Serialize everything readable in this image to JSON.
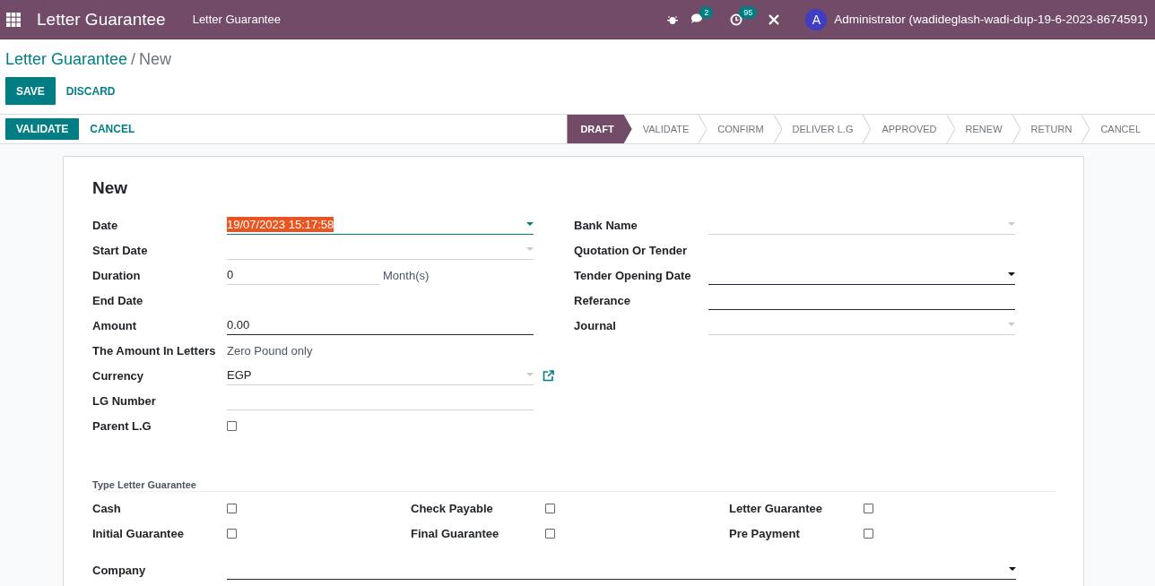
{
  "navbar": {
    "app_name": "Letter Guarantee",
    "menu": "Letter Guarantee",
    "messages_count": "2",
    "activities_count": "95",
    "avatar": "A",
    "user": "Administrator (wadideglash-wadi-dup-19-6-2023-8674591)"
  },
  "breadcrumb": {
    "parent": "Letter Guarantee",
    "separator": "/",
    "current": "New"
  },
  "actions": [
    {
      "label": "SAVE",
      "primary": true
    },
    {
      "label": "DISCARD",
      "primary": false
    }
  ],
  "status_buttons": [
    {
      "label": "VALIDATE",
      "primary": true
    },
    {
      "label": "CANCEL",
      "primary": false
    }
  ],
  "stages": [
    {
      "label": "DRAFT",
      "selected": true
    },
    {
      "label": "VALIDATE",
      "selected": false
    },
    {
      "label": "CONFIRM",
      "selected": false
    },
    {
      "label": "DELIVER L.G",
      "selected": false
    },
    {
      "label": "APPROVED",
      "selected": false
    },
    {
      "label": "RENEW",
      "selected": false
    },
    {
      "label": "RETURN",
      "selected": false
    },
    {
      "label": "CANCEL",
      "selected": false
    }
  ],
  "form": {
    "title": "New",
    "left_fields": [
      {
        "label": "Date",
        "kind": "select",
        "value": "19/07/2023 15:17:58",
        "focused": true,
        "required": false
      },
      {
        "label": "Start Date",
        "kind": "select",
        "focused": false,
        "required": false
      },
      {
        "label": "Duration",
        "kind": "input",
        "value": "0",
        "suffix": "Month(s)",
        "focused": false,
        "required": false
      },
      {
        "label": "End Date",
        "kind": "readonly"
      },
      {
        "label": "Amount",
        "kind": "input",
        "value": "0.00",
        "focused": false,
        "required": true
      },
      {
        "label": "The Amount In Letters",
        "kind": "readonly",
        "value": "Zero Pound only"
      },
      {
        "label": "Currency",
        "kind": "select",
        "value": "EGP",
        "external_link": true,
        "focused": false,
        "required": false
      },
      {
        "label": "LG Number",
        "kind": "input",
        "focused": false,
        "required": false
      },
      {
        "label": "Parent L.G",
        "kind": "checkbox",
        "checked": false
      }
    ],
    "right_fields": [
      {
        "label": "Bank Name",
        "kind": "select",
        "focused": false,
        "required": false
      },
      {
        "label": "Quotation Or Tender",
        "kind": "readonly"
      },
      {
        "label": "Tender Opening Date",
        "kind": "select",
        "focused": false,
        "required": true
      },
      {
        "label": "Referance",
        "kind": "input",
        "focused": false,
        "required": true
      },
      {
        "label": "Journal",
        "kind": "select",
        "focused": false,
        "required": false
      }
    ],
    "type_section": {
      "title": "Type Letter Guarantee",
      "options": [
        {
          "label": "Cash",
          "checked": false
        },
        {
          "label": "Check Payable",
          "checked": false
        },
        {
          "label": "Letter Guarantee",
          "checked": false
        },
        {
          "label": "Initial Guarantee",
          "checked": false
        },
        {
          "label": "Final Guarantee",
          "checked": false
        },
        {
          "label": "Pre Payment",
          "checked": false
        }
      ]
    },
    "company": {
      "label": "Company",
      "kind": "select",
      "focused": false,
      "required": true
    }
  }
}
